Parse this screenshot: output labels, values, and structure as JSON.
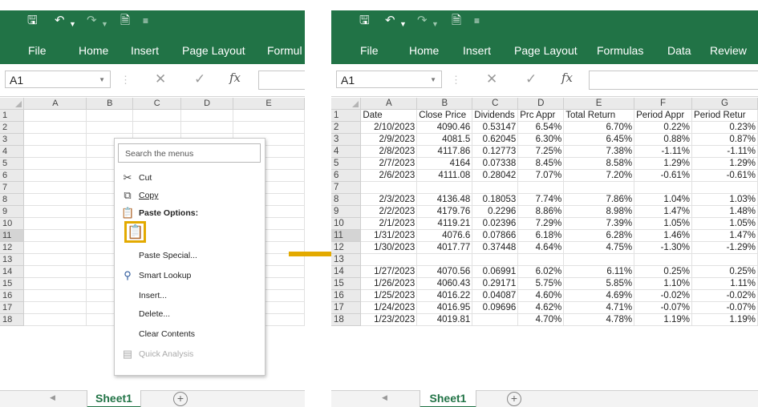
{
  "colors": {
    "ribbon": "#217346",
    "highlight": "#e3aa00"
  },
  "left": {
    "menubar": [
      "File",
      "Home",
      "Insert",
      "Page Layout",
      "Formul"
    ],
    "namebox": "A1",
    "fx": "fx",
    "columns": [
      "A",
      "B",
      "C",
      "D",
      "E"
    ],
    "rows": [
      "1",
      "2",
      "3",
      "4",
      "5",
      "6",
      "7",
      "8",
      "9",
      "10",
      "11",
      "12",
      "13",
      "14",
      "15",
      "16",
      "17",
      "18"
    ],
    "sheet_tab": "Sheet1",
    "context_menu": {
      "search_placeholder": "Search the menus",
      "cut": "Cut",
      "copy": "Copy",
      "paste_options": "Paste Options:",
      "paste_special": "Paste Special...",
      "smart_lookup": "Smart Lookup",
      "insert": "Insert...",
      "delete": "Delete...",
      "clear_contents": "Clear Contents",
      "quick_analysis": "Quick Analysis"
    }
  },
  "right": {
    "menubar": [
      "File",
      "Home",
      "Insert",
      "Page Layout",
      "Formulas",
      "Data",
      "Review"
    ],
    "namebox": "A1",
    "fx": "fx",
    "columns": [
      "A",
      "B",
      "C",
      "D",
      "E",
      "F",
      "G"
    ],
    "rows": [
      [
        "1",
        "Date",
        "Close Price",
        "Dividends",
        "Prc Appr",
        "Total Return",
        "Period Appr",
        "Period Retur"
      ],
      [
        "2",
        "2/10/2023",
        "4090.46",
        "0.53147",
        "6.54%",
        "6.70%",
        "0.22%",
        "0.23%"
      ],
      [
        "3",
        "2/9/2023",
        "4081.5",
        "0.62045",
        "6.30%",
        "6.45%",
        "0.88%",
        "0.87%"
      ],
      [
        "4",
        "2/8/2023",
        "4117.86",
        "0.12773",
        "7.25%",
        "7.38%",
        "-1.11%",
        "-1.11%"
      ],
      [
        "5",
        "2/7/2023",
        "4164",
        "0.07338",
        "8.45%",
        "8.58%",
        "1.29%",
        "1.29%"
      ],
      [
        "6",
        "2/6/2023",
        "4111.08",
        "0.28042",
        "7.07%",
        "7.20%",
        "-0.61%",
        "-0.61%"
      ],
      [
        "7",
        "",
        "",
        "",
        "",
        "",
        "",
        ""
      ],
      [
        "8",
        "2/3/2023",
        "4136.48",
        "0.18053",
        "7.74%",
        "7.86%",
        "1.04%",
        "1.03%"
      ],
      [
        "9",
        "2/2/2023",
        "4179.76",
        "0.2296",
        "8.86%",
        "8.98%",
        "1.47%",
        "1.48%"
      ],
      [
        "10",
        "2/1/2023",
        "4119.21",
        "0.02396",
        "7.29%",
        "7.39%",
        "1.05%",
        "1.05%"
      ],
      [
        "11",
        "1/31/2023",
        "4076.6",
        "0.07866",
        "6.18%",
        "6.28%",
        "1.46%",
        "1.47%"
      ],
      [
        "12",
        "1/30/2023",
        "4017.77",
        "0.37448",
        "4.64%",
        "4.75%",
        "-1.30%",
        "-1.29%"
      ],
      [
        "13",
        "",
        "",
        "",
        "",
        "",
        "",
        ""
      ],
      [
        "14",
        "1/27/2023",
        "4070.56",
        "0.06991",
        "6.02%",
        "6.11%",
        "0.25%",
        "0.25%"
      ],
      [
        "15",
        "1/26/2023",
        "4060.43",
        "0.29171",
        "5.75%",
        "5.85%",
        "1.10%",
        "1.11%"
      ],
      [
        "16",
        "1/25/2023",
        "4016.22",
        "0.04087",
        "4.60%",
        "4.69%",
        "-0.02%",
        "-0.02%"
      ],
      [
        "17",
        "1/24/2023",
        "4016.95",
        "0.09696",
        "4.62%",
        "4.71%",
        "-0.07%",
        "-0.07%"
      ],
      [
        "18",
        "1/23/2023",
        "4019.81",
        "",
        "4.70%",
        "4.78%",
        "1.19%",
        "1.19%"
      ]
    ],
    "sheet_tab": "Sheet1"
  }
}
